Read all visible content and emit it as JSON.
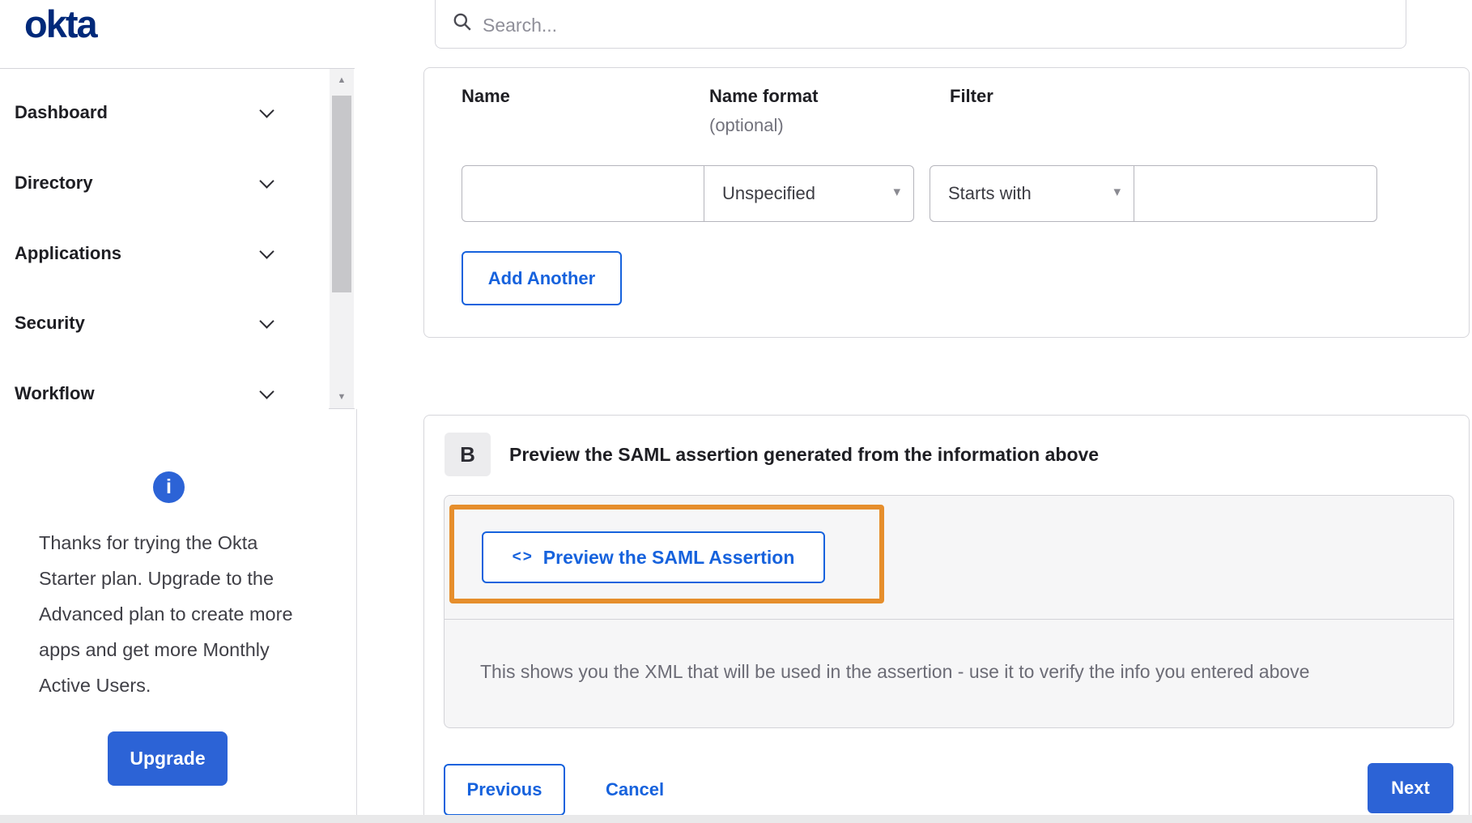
{
  "colors": {
    "brand_navy": "#00297a",
    "link_blue": "#1662dd",
    "button_blue": "#2c63d6",
    "annotation_orange": "#e68e2c",
    "panel_gray": "#f6f6f7"
  },
  "header": {
    "logo_text": "okta",
    "search_placeholder": "Search..."
  },
  "sidebar": {
    "items": [
      {
        "label": "Dashboard"
      },
      {
        "label": "Directory"
      },
      {
        "label": "Applications"
      },
      {
        "label": "Security"
      },
      {
        "label": "Workflow"
      }
    ],
    "upgrade": {
      "info_glyph": "i",
      "message": "Thanks for trying the Okta Starter plan. Upgrade to the Advanced plan to create more apps and get more Monthly Active Users.",
      "button_label": "Upgrade"
    }
  },
  "attribute_form": {
    "name_label": "Name",
    "name_format_label": "Name format",
    "name_format_sublabel": "(optional)",
    "filter_label": "Filter",
    "name_value": "",
    "name_format_selected": "Unspecified",
    "filter_operator_selected": "Starts with",
    "filter_value": "",
    "add_another_label": "Add Another"
  },
  "preview_section": {
    "step_letter": "B",
    "heading": "Preview the SAML assertion generated from the information above",
    "code_icon_glyph": "<>",
    "preview_button_label": "Preview the SAML Assertion",
    "description": "This shows you the XML that will be used in the assertion - use it to verify the info you entered above"
  },
  "footer": {
    "previous_label": "Previous",
    "cancel_label": "Cancel",
    "next_label": "Next"
  },
  "scrollbar": {
    "up_glyph": "▲",
    "down_glyph": "▼"
  },
  "dropdown_caret_glyph": "▾"
}
